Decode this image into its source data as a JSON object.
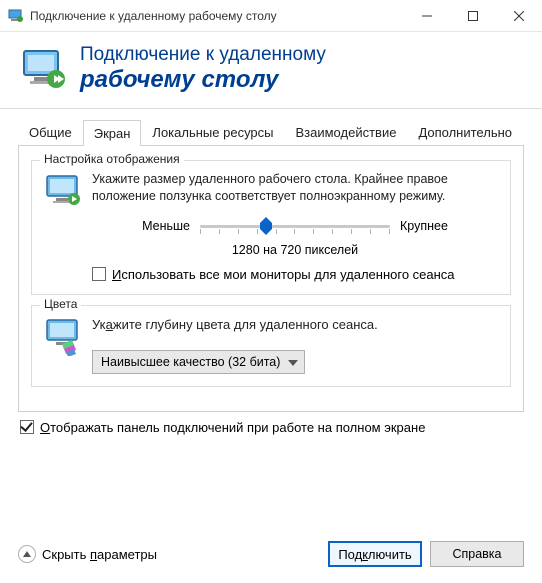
{
  "titlebar": {
    "text": "Подключение к удаленному рабочему столу"
  },
  "banner": {
    "line1": "Подключение к удаленному",
    "line2": "рабочему столу"
  },
  "tabs": {
    "items": [
      {
        "label": "Общие"
      },
      {
        "label": "Экран"
      },
      {
        "label": "Локальные ресурсы"
      },
      {
        "label": "Взаимодействие"
      },
      {
        "label": "Дополнительно"
      }
    ],
    "active_index": 1
  },
  "display_group": {
    "title": "Настройка отображения",
    "description": "Укажите размер удаленного рабочего стола. Крайнее правое положение ползунка соответствует полноэкранному режиму.",
    "slider_min_label": "Меньше",
    "slider_max_label": "Крупнее",
    "resolution_label": "1280 на 720 пикселей",
    "use_all_monitors_pre": "",
    "use_all_monitors_u": "И",
    "use_all_monitors_post": "спользовать все мои мониторы для удаленного сеанса",
    "use_all_monitors_checked": false
  },
  "colors_group": {
    "title": "Цвета",
    "description_pre": "Ук",
    "description_u": "а",
    "description_post": "жите глубину цвета для удаленного сеанса.",
    "selected": "Наивысшее качество (32 бита)"
  },
  "show_bar": {
    "pre": "",
    "u": "О",
    "post": "тображать панель подключений при работе на полном экране",
    "checked": true
  },
  "footer": {
    "collapse_pre": "Скрыть ",
    "collapse_u": "п",
    "collapse_post": "араметры",
    "connect_pre": "Под",
    "connect_u": "к",
    "connect_post": "лючить",
    "help": "Справка"
  }
}
